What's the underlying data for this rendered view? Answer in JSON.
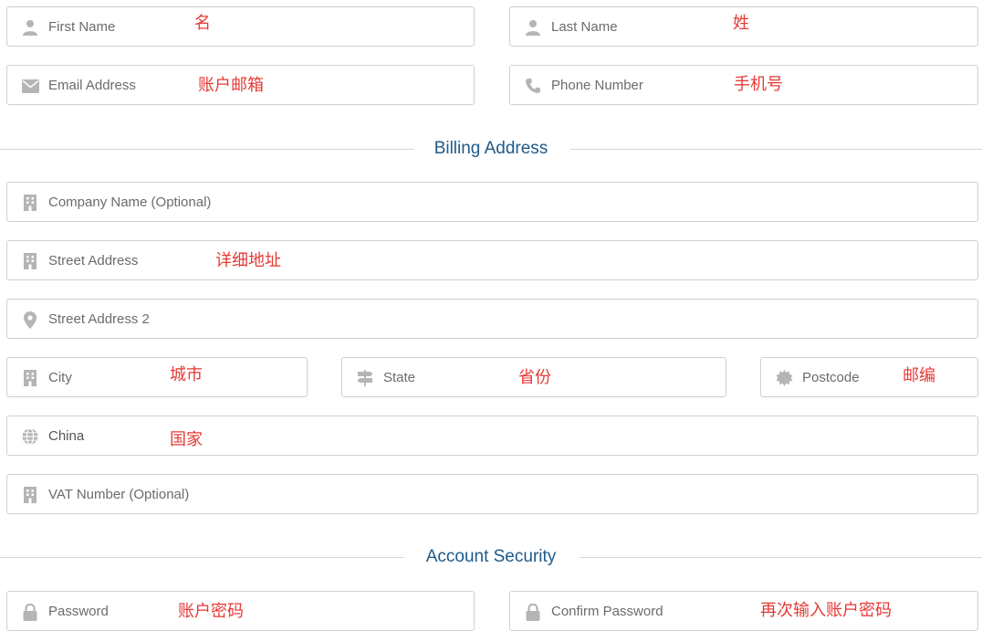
{
  "personal": {
    "first_name": {
      "placeholder": "First Name",
      "note": "名"
    },
    "last_name": {
      "placeholder": "Last Name",
      "note": "姓"
    },
    "email": {
      "placeholder": "Email Address",
      "note": "账户邮箱"
    },
    "phone": {
      "placeholder": "Phone Number",
      "note": "手机号"
    }
  },
  "billing": {
    "section_title": "Billing Address",
    "company": {
      "placeholder": "Company Name (Optional)"
    },
    "street": {
      "placeholder": "Street Address",
      "note": "详细地址"
    },
    "street2": {
      "placeholder": "Street Address 2"
    },
    "city": {
      "placeholder": "City",
      "note": "城市"
    },
    "state": {
      "placeholder": "State",
      "note": "省份"
    },
    "postcode": {
      "placeholder": "Postcode",
      "note": "邮编"
    },
    "country": {
      "value": "China",
      "note": "国家"
    },
    "vat": {
      "placeholder": "VAT Number (Optional)"
    }
  },
  "security": {
    "section_title": "Account Security",
    "password": {
      "placeholder": "Password",
      "note": "账户密码"
    },
    "confirm_password": {
      "placeholder": "Confirm Password",
      "note": "再次输入账户密码"
    }
  },
  "colors": {
    "note": "#e53935",
    "section_title": "#1e5a8a",
    "icon": "#b5b5b5",
    "border": "#cfcfcf"
  },
  "icons": {
    "first_name": "user-icon",
    "last_name": "user-icon",
    "email": "envelope-icon",
    "phone": "phone-icon",
    "company": "building-icon",
    "street": "building-icon",
    "street2": "map-marker-icon",
    "city": "building-icon",
    "state": "signpost-icon",
    "postcode": "certificate-icon",
    "country": "globe-icon",
    "vat": "building-icon",
    "password": "lock-icon",
    "confirm_password": "lock-icon"
  }
}
